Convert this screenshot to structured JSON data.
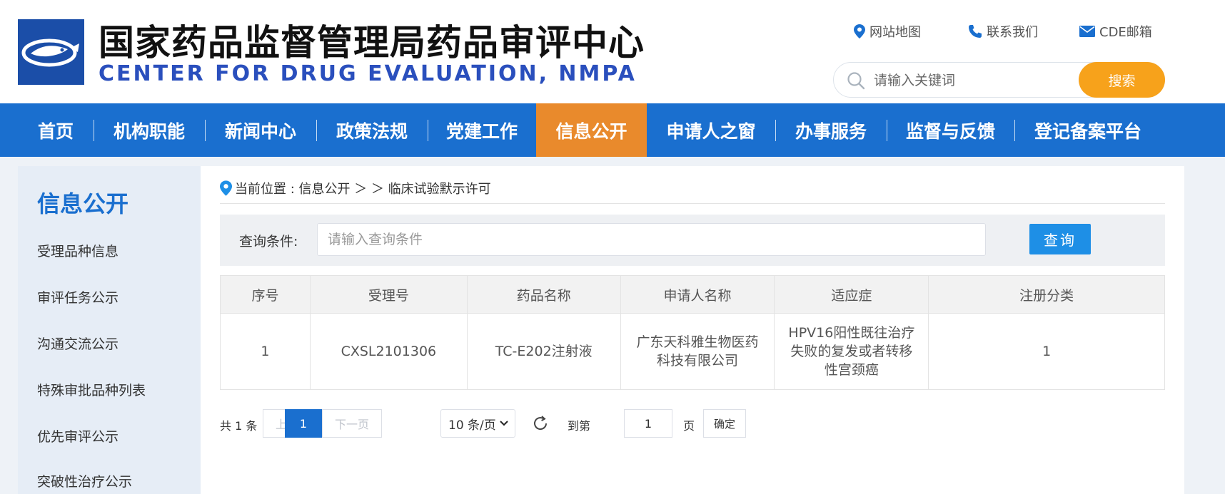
{
  "header": {
    "title": "国家药品监督管理局药品审评中心",
    "subtitle": "CENTER FOR DRUG EVALUATION, NMPA",
    "links": {
      "sitemap": "网站地图",
      "contact": "联系我们",
      "email": "CDE邮箱"
    },
    "search": {
      "placeholder": "请输入关键词",
      "button": "搜索"
    }
  },
  "nav": {
    "items": [
      "首页",
      "机构职能",
      "新闻中心",
      "政策法规",
      "党建工作",
      "信息公开",
      "申请人之窗",
      "办事服务",
      "监督与反馈",
      "登记备案平台"
    ],
    "active": "信息公开"
  },
  "sidebar": {
    "title": "信息公开",
    "items": [
      "受理品种信息",
      "审评任务公示",
      "沟通交流公示",
      "特殊审批品种列表",
      "优先审评公示",
      "突破性治疗公示"
    ]
  },
  "breadcrumb": "当前位置 : 信息公开 ＞ ＞ 临床试验默示许可",
  "query": {
    "label": "查询条件:",
    "placeholder": "请输入查询条件",
    "button": "查询"
  },
  "table": {
    "headers": [
      "序号",
      "受理号",
      "药品名称",
      "申请人名称",
      "适应症",
      "注册分类"
    ],
    "rows": [
      [
        "1",
        "CXSL2101306",
        "TC-E202注射液",
        "广东天科雅生物医药科技有限公司",
        "HPV16阳性既往治疗失败的复发或者转移性宫颈癌",
        "1"
      ]
    ]
  },
  "pagination": {
    "total": "共 1 条",
    "prev": "上一页",
    "current": "1",
    "next": "下一页",
    "page_size": "10 条/页",
    "goto_label": "到第",
    "goto_value": "1",
    "page_label": "页",
    "confirm": "确定"
  },
  "colors": {
    "nav_bg": "#1a6fcf",
    "nav_active": "#e98a2c",
    "search_btn": "#f7a21b",
    "query_btn": "#1e8fe6",
    "subtitle": "#2a4fbd"
  }
}
